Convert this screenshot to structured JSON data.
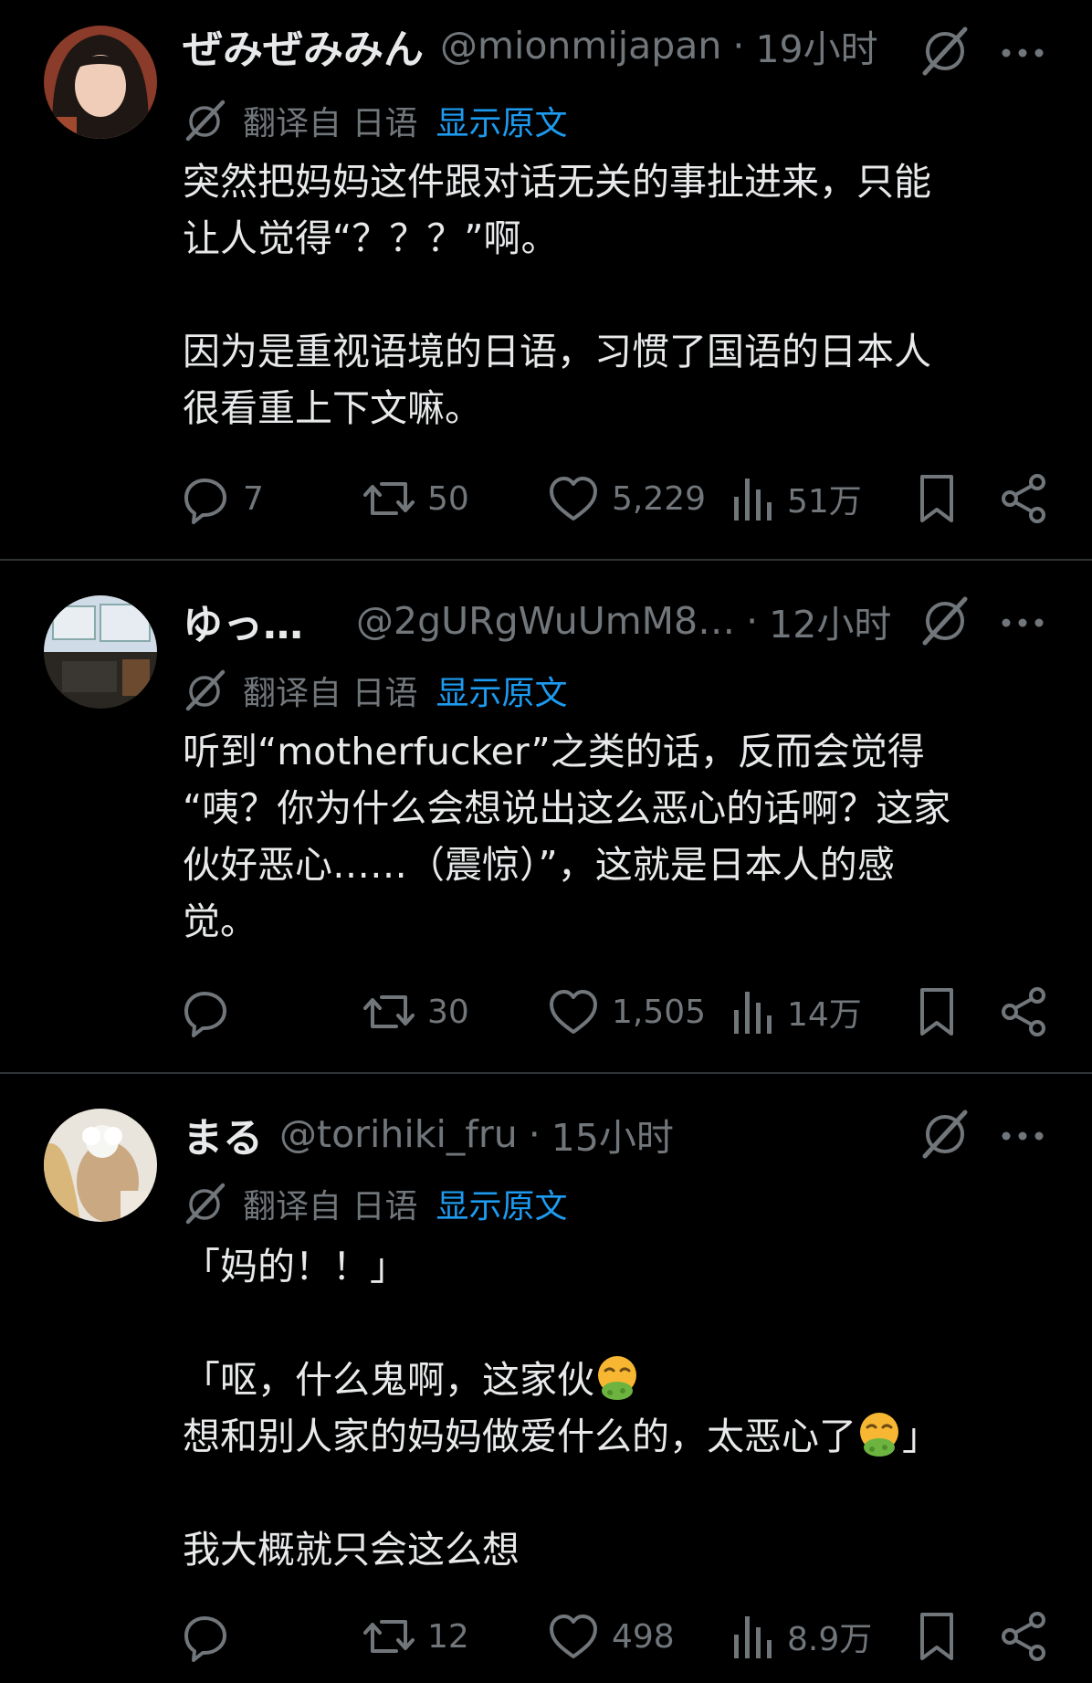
{
  "translate": {
    "label": "翻译自 日语",
    "link": "显示原文"
  },
  "posts": [
    {
      "name": "ぜみぜみみん",
      "handle": "@mionmijapan",
      "time": "19小时",
      "lines": [
        "突然把妈妈这件跟对话无关的事扯进来，只能",
        "让人觉得“？？？”啊。",
        "",
        "因为是重视语境的日语，习惯了国语的日本人",
        "很看重上下文嘛。"
      ],
      "replies": "7",
      "reposts": "50",
      "likes": "5,229",
      "views": "51万"
    },
    {
      "name": "ゆっ…",
      "handle": "@2gURgWuUmM8…",
      "time": "12小时",
      "lines": [
        "听到“motherfucker”之类的话，反而会觉得",
        "“咦？你为什么会想说出这么恶心的话啊？这家",
        "伙好恶心……（震惊）”，这就是日本人的感",
        "觉。"
      ],
      "replies": "",
      "reposts": "30",
      "likes": "1,505",
      "views": "14万"
    },
    {
      "name": "まる",
      "handle": "@torihiki_fru",
      "time": "15小时",
      "lines": [
        "「妈的！！」",
        "",
        "「呕，什么鬼啊，这家伙",
        "想和别人家的妈妈做爱什么的，太恶心了",
        "",
        "我大概就只会这么想"
      ],
      "line_suffix": [
        "",
        "",
        "",
        "」",
        "",
        ""
      ],
      "replies": "",
      "reposts": "12",
      "likes": "498",
      "views": "8.9万"
    }
  ],
  "colors": {
    "accent": "#1d9bf0",
    "muted": "#71767b",
    "text": "#e7e9ea",
    "divider": "#2f3336"
  },
  "icons": [
    "grok-icon",
    "more-icon",
    "translate-icon",
    "reply-icon",
    "repost-icon",
    "like-icon",
    "views-icon",
    "bookmark-icon",
    "share-icon",
    "nauseated-face-emoji"
  ]
}
